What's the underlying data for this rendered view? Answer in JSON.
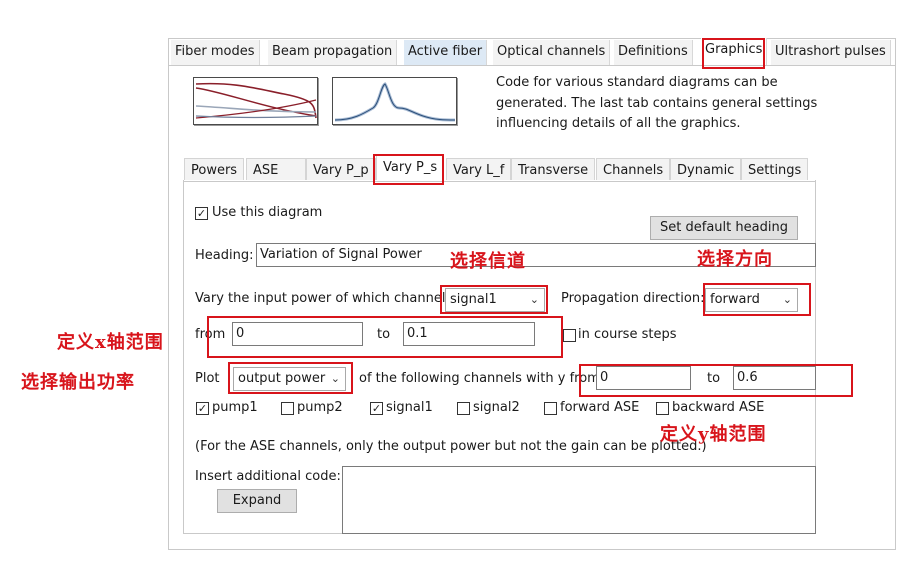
{
  "top_tabs": [
    {
      "label": "Fiber modes"
    },
    {
      "label": "Beam propagation"
    },
    {
      "label": "Active fiber"
    },
    {
      "label": "Optical channels"
    },
    {
      "label": "Definitions"
    },
    {
      "label": "Graphics"
    },
    {
      "label": "Ultrashort pulses"
    }
  ],
  "description": "Code for various standard diagrams can be generated. The last tab contains general settings influencing details of all the graphics.",
  "sub_tabs": [
    {
      "label": "Powers"
    },
    {
      "label": "ASE"
    },
    {
      "label": "Vary P_p"
    },
    {
      "label": "Vary P_s"
    },
    {
      "label": "Vary L_f"
    },
    {
      "label": "Transverse"
    },
    {
      "label": "Channels"
    },
    {
      "label": "Dynamic"
    },
    {
      "label": "Settings"
    }
  ],
  "form": {
    "use_diagram_label": "Use this diagram",
    "use_diagram_checked": true,
    "set_default_heading": "Set default heading",
    "heading_label": "Heading:",
    "heading_value": "Variation of Signal Power",
    "vary_label": "Vary the input power of which channel:",
    "channel_value": "signal1",
    "prop_dir_label": "Propagation direction:",
    "prop_dir_value": "forward",
    "from_label": "from",
    "from_value": "0",
    "to_label": "to",
    "to_value": "0.1",
    "course_steps_label": "in course steps",
    "plot_label": "Plot",
    "plot_value": "output power",
    "following_label": "of the following channels with y from",
    "y_from_value": "0",
    "y_to_label": "to",
    "y_to_value": "0.6",
    "channels": [
      {
        "label": "pump1",
        "checked": true
      },
      {
        "label": "pump2",
        "checked": false
      },
      {
        "label": "signal1",
        "checked": true
      },
      {
        "label": "signal2",
        "checked": false
      },
      {
        "label": "forward ASE",
        "checked": false
      },
      {
        "label": "backward ASE",
        "checked": false
      }
    ],
    "ase_note": "(For the ASE channels, only the output power but not the gain can be plotted.)",
    "insert_code_label": "Insert additional code:",
    "expand_label": "Expand"
  },
  "annotations": {
    "select_channel": "选择信道",
    "select_direction": "选择方向",
    "define_x_range": "定义x轴范围",
    "select_output_power": "选择输出功率",
    "define_y_range": "定义y轴范围"
  },
  "colors": {
    "annotation_red": "#d8141b",
    "selected_tab_bg": "#dde9f5"
  }
}
